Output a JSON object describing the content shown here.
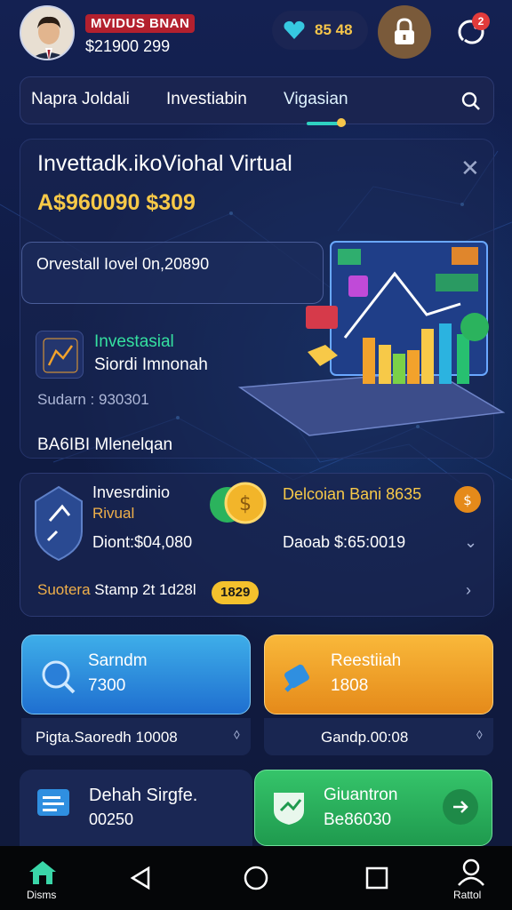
{
  "header": {
    "user_name": "MVIDUS BNAN",
    "user_balance": "$21900 299",
    "gems_value": "85 48",
    "notification_count": "2"
  },
  "tabs": [
    {
      "label": "Napra Joldali"
    },
    {
      "label": "Investiabin"
    },
    {
      "label": "Vigasian"
    }
  ],
  "hero": {
    "title": "Invettadk.ikoViohal Virtual",
    "amount": "A$960090 $309",
    "field_text": "Orvestall Iovel 0n,20890",
    "invest_line1": "Investasial",
    "invest_line2": "Siordi Imnonah",
    "sub_label": "Sudarn : 930301",
    "section_title": "BA6IBI Mlenelqan"
  },
  "investment_card": {
    "title": "Invesrdinio",
    "subtitle": "Rivual",
    "detail": "Diont:$04,080",
    "right_title": "Delcoian",
    "right_title_accent": "Bani 8635",
    "right_detail": "Daoab $:65:0019",
    "status_key": "Suotera",
    "status_text": "Stamp 2t 1d28l",
    "status_pill": "1829"
  },
  "actions": [
    {
      "title": "Sarndm",
      "value": "7300",
      "sub": "Pigta.Saoredh 10008"
    },
    {
      "title": "Reestiiah",
      "value": "1808",
      "sub": "Gandp.00:08"
    }
  ],
  "bottom_cards": [
    {
      "title": "Dehah Sirgfe.",
      "value": "00250"
    },
    {
      "title": "Giuantron",
      "value": "Be86030"
    }
  ],
  "nav": {
    "home_label": "Disms",
    "profile_label": "Rattol"
  },
  "colors": {
    "background": "#101a3b",
    "accent_gold": "#f7c948",
    "accent_green": "#35e0a0",
    "button_blue": "#2f8fe0",
    "button_orange": "#f2a22c",
    "button_green": "#2bb35d"
  }
}
